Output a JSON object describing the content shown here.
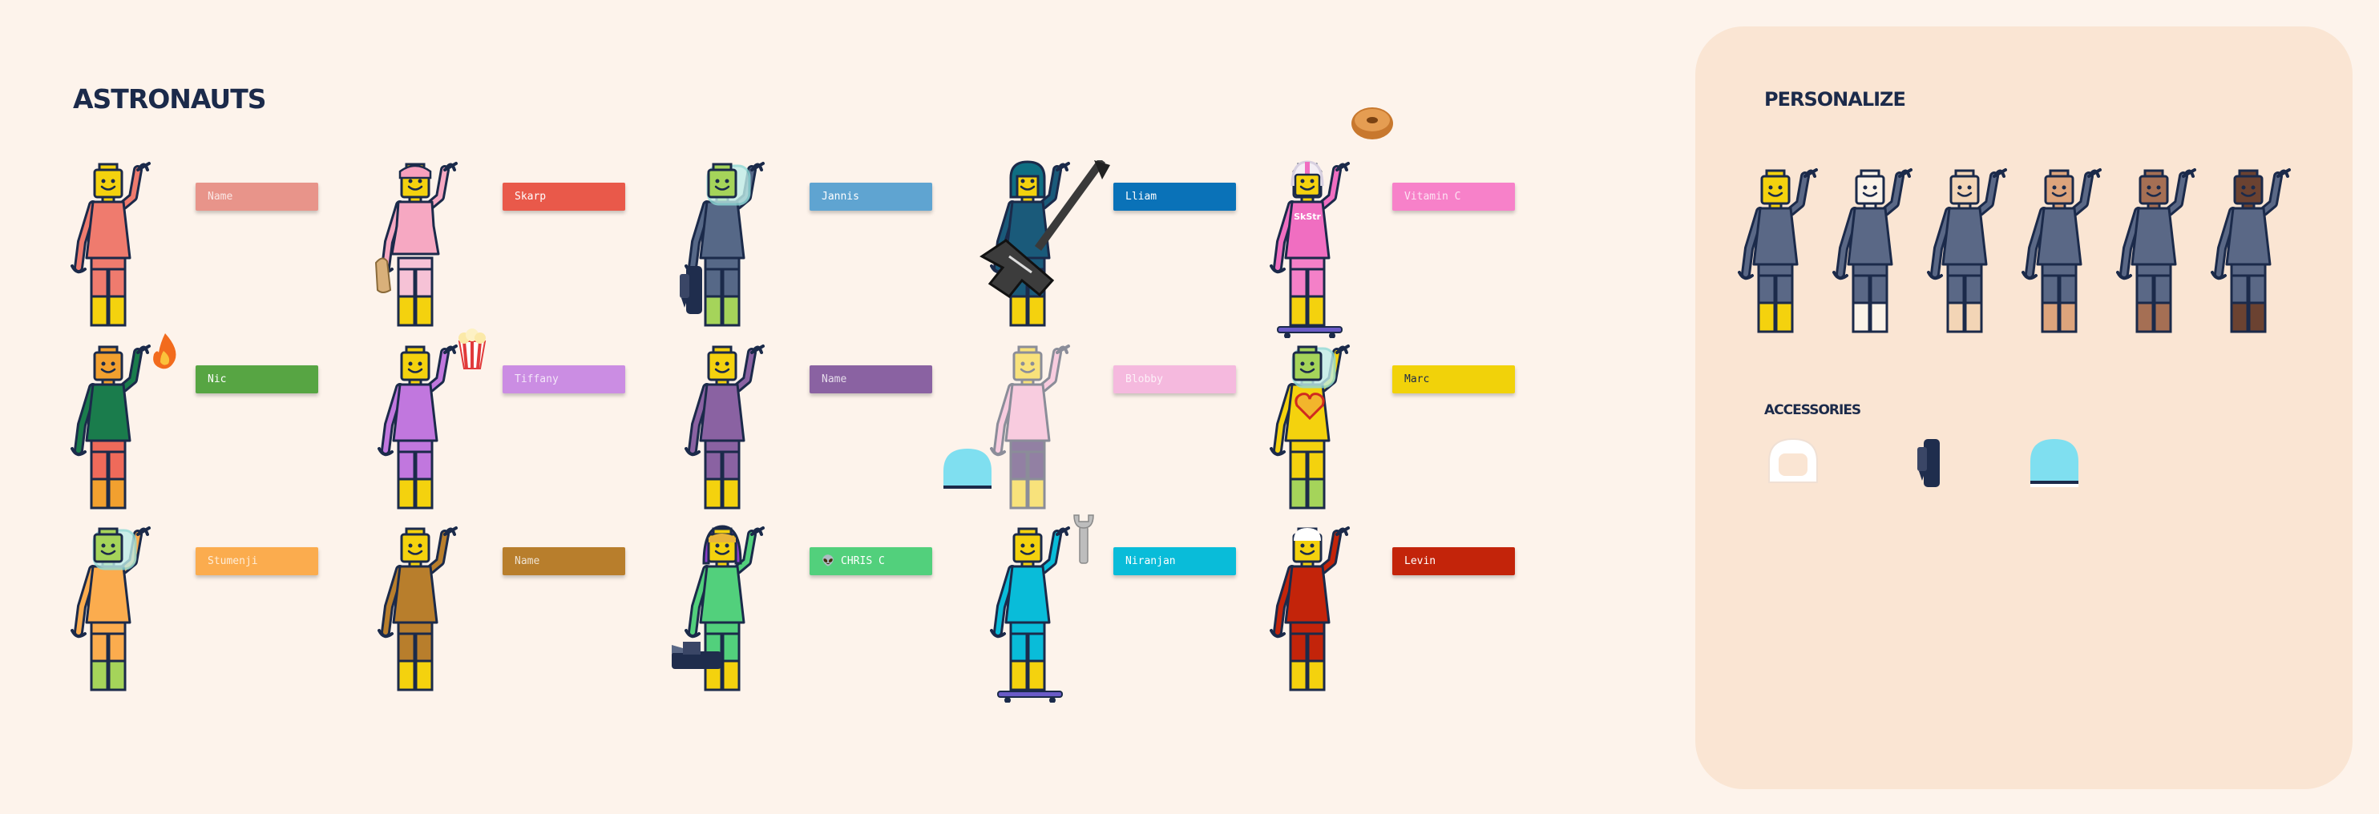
{
  "astronauts": {
    "title": "ASTRONAUTS",
    "items": [
      {
        "name": "Name",
        "tag": "#e8948a",
        "shirt": "#ef7b6e",
        "legs": "#ef7b6e",
        "skin": "#f4d20e",
        "head": "plain",
        "tagStyle": "faded",
        "accessory": ""
      },
      {
        "name": "Skarp",
        "tag": "#e9594a",
        "shirt": "#f6a8c2",
        "legs": "#f6c2d6",
        "skin": "#f4d20e",
        "head": "pink-hair",
        "tagStyle": "",
        "accessory": "bread-icon",
        "dress": true
      },
      {
        "name": "Jannis",
        "tag": "#5fa4d1",
        "shirt": "#566887",
        "legs": "#566887",
        "skin": "#a5d45a",
        "head": "helmet",
        "tagStyle": "",
        "accessory": "jetpack-icon"
      },
      {
        "name": "Lliam",
        "tag": "#0a72b8",
        "shirt": "#1a5a7a",
        "legs": "#1a5a7a",
        "skin": "#f4d20e",
        "head": "teal-hood",
        "tagStyle": "",
        "accessory": "guitar-icon"
      },
      {
        "name": "Vitamin C",
        "tag": "#f781c9",
        "shirt": "#f06ec1",
        "legs": "#f480c8",
        "skin": "#f4d20e",
        "head": "white-helmet",
        "tagStyle": "faded",
        "accessory": "bagel-icon",
        "skate": true,
        "shirtText": "SkStr"
      },
      {
        "name": "Nic",
        "tag": "#57a543",
        "shirt": "#1a7c4c",
        "legs": "#ef6a5a",
        "skin": "#f2a02f",
        "head": "plain",
        "tagStyle": "",
        "accessory": "fire-icon"
      },
      {
        "name": "Tiffany",
        "tag": "#cb8de3",
        "shirt": "#c177de",
        "legs": "#c177de",
        "skin": "#f4d20e",
        "head": "plain",
        "tagStyle": "faded",
        "accessory": "popcorn-icon"
      },
      {
        "name": "Name",
        "tag": "#8a62a2",
        "shirt": "#8a62a2",
        "legs": "#8a62a2",
        "skin": "#f4d20e",
        "head": "plain",
        "tagStyle": "faded",
        "accessory": ""
      },
      {
        "name": "Blobby",
        "tag": "#f5b9de",
        "shirt": "#f4a6d4",
        "legs": "#2a0f5e",
        "skin": "#f4d20e",
        "head": "plain",
        "tagStyle": "faded",
        "accessory": "helmet-bubble-icon",
        "ghost": true
      },
      {
        "name": "Marc",
        "tag": "#f1d20a",
        "shirt": "#f4d20e",
        "legs": "#f4d20e",
        "skin": "#a5d45a",
        "head": "helmet",
        "tagStyle": "dark",
        "accessory": "heart-icon"
      },
      {
        "name": "Stumenji",
        "tag": "#fbac4e",
        "shirt": "#fbac4e",
        "legs": "#fbac4e",
        "skin": "#a5d45a",
        "head": "helmet",
        "tagStyle": "faded",
        "accessory": ""
      },
      {
        "name": "Name",
        "tag": "#b87e2c",
        "shirt": "#b87e2c",
        "legs": "#b87e2c",
        "skin": "#f4d20e",
        "head": "plain",
        "tagStyle": "faded",
        "accessory": ""
      },
      {
        "name": "👽 CHRIS C",
        "tag": "#52d07c",
        "shirt": "#52d07c",
        "legs": "#52d07c",
        "skin": "#f4d20e",
        "head": "purple-hair",
        "tagStyle": "",
        "accessory": "camera-icon"
      },
      {
        "name": "Niranjan",
        "tag": "#09bcd9",
        "shirt": "#09bcd9",
        "legs": "#09bcd9",
        "skin": "#f4d20e",
        "head": "plain",
        "tagStyle": "",
        "accessory": "wrench-icon",
        "skate": true
      },
      {
        "name": "Levin",
        "tag": "#c3240a",
        "shirt": "#c3240a",
        "legs": "#c3240a",
        "skin": "#f4d20e",
        "head": "white-cap",
        "tagStyle": "",
        "accessory": ""
      }
    ]
  },
  "personalize": {
    "title": "PERSONALIZE",
    "skin_tones": [
      "#f4d20e",
      "#fbf3e8",
      "#f3d5b6",
      "#dda47c",
      "#a56f54",
      "#6b4231"
    ]
  },
  "accessories": {
    "title": "ACCESSORIES",
    "items": [
      "helmet-white-icon",
      "jetpack-icon",
      "helmet-bubble-icon"
    ]
  },
  "colors": {
    "outline": "#1b2a4a",
    "background": "#fdf3eb",
    "panel": "#fae5d3"
  }
}
